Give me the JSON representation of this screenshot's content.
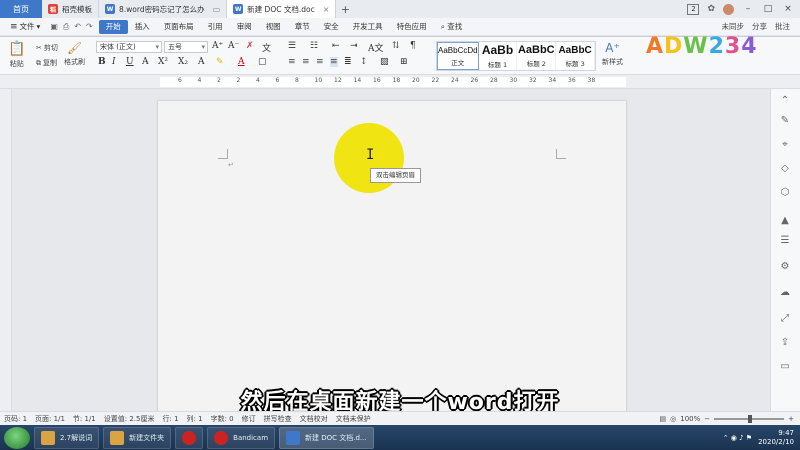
{
  "tabs": {
    "home": "首页",
    "items": [
      {
        "label": "稻壳模板",
        "icon": "daoke-icon",
        "color": "#e0433a"
      },
      {
        "label": "8.word密码忘记了怎么办",
        "icon": "wps-doc-icon",
        "color": "#3f78c9"
      },
      {
        "label": "新建 DOC 文档.doc",
        "icon": "wps-doc-icon",
        "color": "#3f78c9"
      }
    ],
    "count_badge": "2"
  },
  "menu": {
    "file": "文件",
    "items": [
      "开始",
      "插入",
      "页面布局",
      "引用",
      "审阅",
      "视图",
      "章节",
      "安全",
      "开发工具",
      "特色应用",
      "查找"
    ],
    "active": "开始",
    "right": [
      "未同步",
      "分享",
      "批注"
    ]
  },
  "ribbon": {
    "paste": "粘贴",
    "cut": "剪切",
    "copy": "复制",
    "format_painter": "格式刷",
    "font_name": "宋体 (正文)",
    "font_size": "五号",
    "new_style": "新样式",
    "styles": [
      {
        "sample": "AaBbCcDd",
        "caption": "正文"
      },
      {
        "sample": "AaBb",
        "caption": "标题 1"
      },
      {
        "sample": "AaBbC",
        "caption": "标题 2"
      },
      {
        "sample": "AaBbC",
        "caption": "标题 3"
      }
    ]
  },
  "logo": {
    "text": "ADW234"
  },
  "ruler": {
    "numbers": [
      "6",
      "4",
      "2",
      "2",
      "4",
      "6",
      "8",
      "10",
      "12",
      "14",
      "16",
      "18",
      "20",
      "22",
      "24",
      "26",
      "28",
      "30",
      "32",
      "34",
      "36",
      "38"
    ]
  },
  "document": {
    "tooltip": "双击编辑页眉"
  },
  "subtitle": "然后在桌面新建一个word打开",
  "status": {
    "page_num": "页码: 1",
    "pages": "页面: 1/1",
    "section": "节: 1/1",
    "settings": "设置值: 2.5厘米",
    "row": "行: 1",
    "col": "列: 1",
    "words": "字数: 0",
    "revise": "修订",
    "spell": "拼写检查",
    "proofread": "文档校对",
    "unprotected": "文档未保护",
    "zoom": "100%"
  },
  "taskbar": {
    "items": [
      {
        "label": "2.7解说词",
        "color": "#d9a441"
      },
      {
        "label": "新建文件夹",
        "color": "#d9a441"
      },
      {
        "label": "",
        "color": "#cc2222"
      },
      {
        "label": "Bandicam",
        "color": "#cc2222"
      },
      {
        "label": "新建 DOC 文档.d...",
        "color": "#3f78c9"
      }
    ],
    "time": "9:47",
    "date": "2020/2/10"
  }
}
